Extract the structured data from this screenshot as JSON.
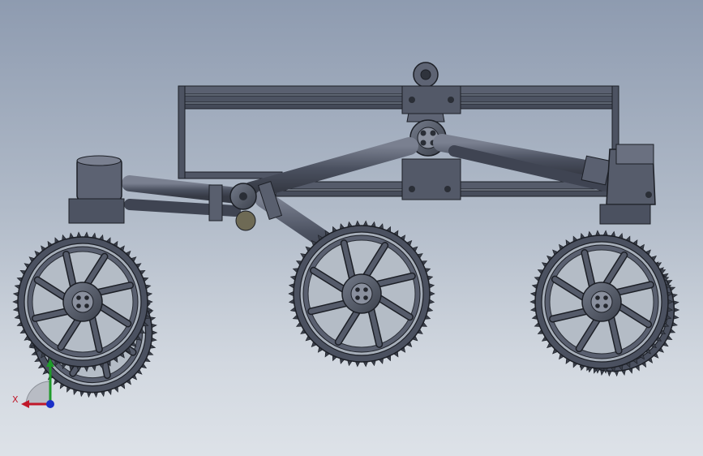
{
  "viewport": {
    "background_top": "#8e9bb0",
    "background_bottom": "#dde2e8",
    "part_color": "#4b5160",
    "part_highlight": "#6a7180",
    "edge_color": "#1c1f26"
  },
  "model": {
    "components": [
      "chassis-frame",
      "top-pivot-bracket",
      "bogie-arm-left",
      "rocker-arm-right",
      "wheel-front-left",
      "wheel-middle",
      "wheel-rear-right"
    ]
  },
  "triad": {
    "x_label": "X",
    "x_color": "#c0182a",
    "y_color": "#1f9a2a",
    "z_color": "#1a2fc8"
  }
}
